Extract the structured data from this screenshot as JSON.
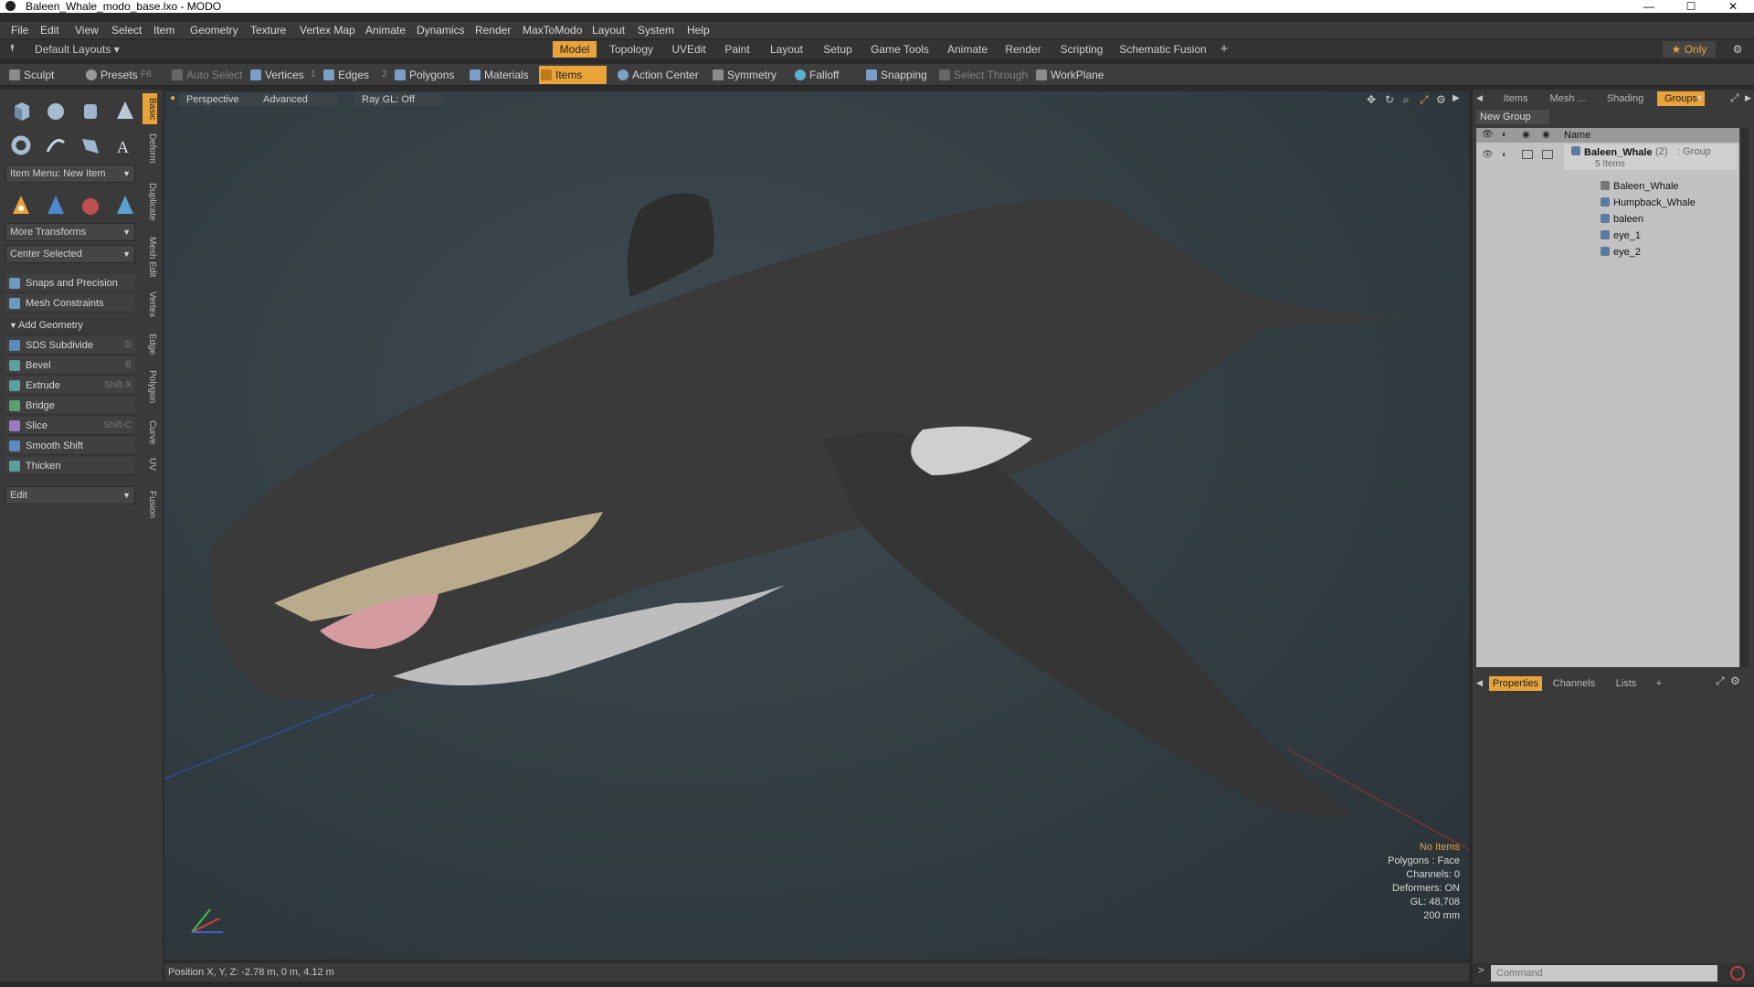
{
  "window": {
    "title": "Baleen_Whale_modo_base.lxo - MODO",
    "minimize": "—",
    "maximize": "☐",
    "close": "✕"
  },
  "menu": [
    "File",
    "Edit",
    "View",
    "Select",
    "Item",
    "Geometry",
    "Texture",
    "Vertex Map",
    "Animate",
    "Dynamics",
    "Render",
    "MaxToModo",
    "Layout",
    "System",
    "Help"
  ],
  "layoutbar": {
    "default_layouts": "Default Layouts ▾",
    "tabs": [
      "Model",
      "Topology",
      "UVEdit",
      "Paint",
      "Layout",
      "Setup",
      "Game Tools",
      "Animate",
      "Render",
      "Scripting",
      "Schematic Fusion"
    ],
    "active_tab": "Model",
    "add": "+",
    "only": "★  Only",
    "settings": "⚙"
  },
  "toolbar": {
    "sculpt": "Sculpt",
    "presets": "Presets",
    "presets_key": "F6",
    "auto_select": "Auto Select",
    "vertices": "Vertices",
    "vertices_num": "1",
    "edges": "Edges",
    "edges_num": "2",
    "polygons": "Polygons",
    "materials": "Materials",
    "items": "Items",
    "action_center": "Action Center",
    "symmetry": "Symmetry",
    "falloff": "Falloff",
    "snapping": "Snapping",
    "select_through": "Select Through",
    "workplane": "WorkPlane"
  },
  "left": {
    "item_menu": "Item Menu: New Item",
    "more_transforms": "More Transforms",
    "center_selected": "Center Selected",
    "snaps": "Snaps and Precision",
    "mesh_constraints": "Mesh Constraints",
    "add_geometry": "Add Geometry",
    "tools": [
      {
        "label": "SDS Subdivide",
        "key": "D"
      },
      {
        "label": "Bevel",
        "key": "B"
      },
      {
        "label": "Extrude",
        "key": "Shift-X"
      },
      {
        "label": "Bridge",
        "key": ""
      },
      {
        "label": "Slice",
        "key": "Shift-C"
      },
      {
        "label": "Smooth Shift",
        "key": ""
      },
      {
        "label": "Thicken",
        "key": ""
      }
    ],
    "edit": "Edit",
    "vtabs": [
      "Basic",
      "Deform",
      "Duplicate",
      "Mesh Edit",
      "Vertex",
      "Edge",
      "Polygon",
      "Curve",
      "UV",
      "Fusion"
    ]
  },
  "viewport": {
    "perspective": "Perspective",
    "advanced": "Advanced",
    "raygl": "Ray GL: Off",
    "info": {
      "no_items": "No Items",
      "polygons": "Polygons : Face",
      "channels": "Channels: 0",
      "deformers": "Deformers: ON",
      "gl": "GL: 48,708",
      "scale": "200 mm"
    }
  },
  "right": {
    "tabs": [
      "Items",
      "Mesh ...",
      "Shading",
      "Groups"
    ],
    "active_tab": "Groups",
    "new_group": "New Group",
    "name_col": "Name",
    "group": {
      "name": "Baleen_Whale",
      "count": "(2)",
      "type": ": Group",
      "items": "5 Items"
    },
    "children": [
      "Baleen_Whale",
      "Humpback_Whale",
      "baleen",
      "eye_1",
      "eye_2"
    ],
    "bottom_tabs": [
      "Properties",
      "Channels",
      "Lists",
      "+"
    ],
    "bottom_active": "Properties"
  },
  "status": {
    "position": "Position X, Y, Z:   -2.78 m, 0 m, 4.12 m"
  },
  "command": {
    "placeholder": "Command"
  },
  "colors": {
    "accent": "#e8a33a",
    "viewport_bg": "#323d42",
    "panel": "#3a3a3a"
  }
}
